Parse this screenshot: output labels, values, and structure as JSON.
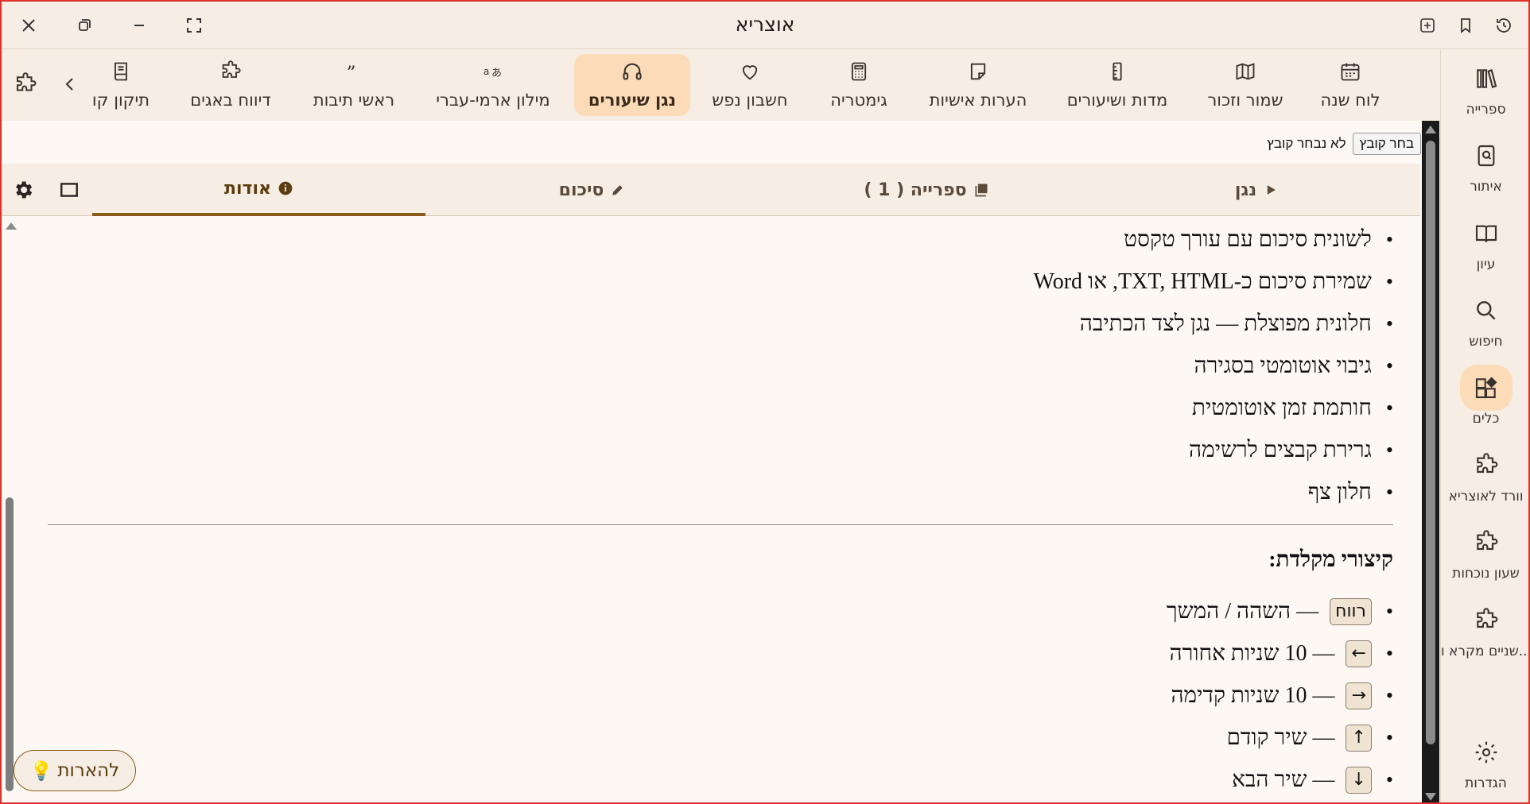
{
  "app": {
    "title": "אוצריא"
  },
  "titlebar": {
    "left_icons": [
      "close-icon",
      "restore-icon",
      "minimize-icon",
      "fullscreen-icon"
    ],
    "right_icons": [
      "new-tab-icon",
      "bookmark-icon",
      "history-icon"
    ]
  },
  "rail": {
    "items": [
      {
        "label": "ספרייה",
        "icon": "books-icon"
      },
      {
        "label": "איתור",
        "icon": "find-book-icon"
      },
      {
        "label": "עיון",
        "icon": "open-book-icon"
      },
      {
        "label": "חיפוש",
        "icon": "search-icon"
      },
      {
        "label": "כלים",
        "icon": "tools-icon",
        "active": true
      },
      {
        "label": "וורד לאוצריא",
        "icon": "puzzle-icon"
      },
      {
        "label": "שעון נוכחות",
        "icon": "puzzle-icon"
      },
      {
        "label": "שניים מקרא ו...",
        "icon": "puzzle-icon"
      }
    ],
    "settings_label": "הגדרות"
  },
  "toolbar": {
    "tools": [
      {
        "label": "לוח שנה",
        "icon": "calendar-icon"
      },
      {
        "label": "שמור וזכור",
        "icon": "map-icon"
      },
      {
        "label": "מדות ושיעורים",
        "icon": "ruler-icon"
      },
      {
        "label": "הערות אישיות",
        "icon": "note-icon"
      },
      {
        "label": "גימטריה",
        "icon": "calculator-icon"
      },
      {
        "label": "חשבון נפש",
        "icon": "heart-icon"
      },
      {
        "label": "נגן שיעורים",
        "icon": "headphones-icon",
        "active": true
      },
      {
        "label": "מילון ארמי-עברי",
        "icon": "translate-icon"
      },
      {
        "label": "ראשי תיבות",
        "icon": "quote-icon"
      },
      {
        "label": "דיווח באגים",
        "icon": "puzzle-icon"
      },
      {
        "label": "תיקון קו",
        "icon": "book-icon"
      }
    ]
  },
  "file": {
    "button_label": "בחר קובץ",
    "status": "לא נבחר קובץ"
  },
  "tabs": {
    "player": "נגן",
    "library": "ספרייה ( 1 )",
    "summary": "סיכום",
    "about": "אודות"
  },
  "features": [
    "לשונית סיכום עם עורך טקסט",
    "שמירת סיכום כ-TXT, HTML, או Word",
    "חלונית מפוצלת — נגן לצד הכתיבה",
    "גיבוי אוטומטי בסגירה",
    "חותמת זמן אוטומטית",
    "גרירת קבצים לרשימה",
    "חלון צף"
  ],
  "shortcuts": {
    "title": "קיצורי מקלדת:",
    "items": [
      {
        "key": "רווח",
        "desc": "— השהה / המשך"
      },
      {
        "key": "←",
        "desc": "— 10 שניות אחורה"
      },
      {
        "key": "→",
        "desc": "— 10 שניות קדימה"
      },
      {
        "key": "↑",
        "desc": "— שיר קודם"
      },
      {
        "key": "↓",
        "desc": "— שיר הבא"
      }
    ]
  },
  "feedback": {
    "label": "להארות"
  },
  "colors": {
    "accent": "#8a5a1a",
    "active_bg": "#fcdcb8",
    "background": "#f7efe6"
  }
}
